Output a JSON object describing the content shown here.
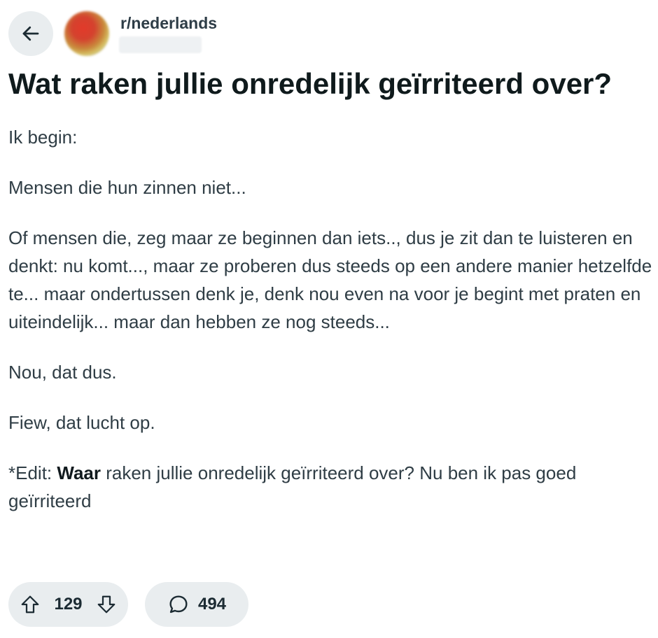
{
  "header": {
    "subreddit": "r/nederlands"
  },
  "post": {
    "title": "Wat raken jullie onredelijk geïrriteerd over?",
    "paragraphs": [
      "Ik begin:",
      "Mensen die hun zinnen niet...",
      "Of mensen die, zeg maar ze beginnen dan iets.., dus je zit dan te luisteren en denkt: nu komt..., maar ze proberen dus steeds op een andere manier hetzelfde te... maar ondertussen denk je, denk nou even na voor je begint met praten en uiteindelijk... maar dan hebben ze nog steeds...",
      "Nou, dat dus.",
      "Fiew, dat lucht op."
    ],
    "edit": {
      "prefix": "*Edit: ",
      "bold": "Waar",
      "rest": " raken jullie onredelijk geïrriteerd over? Nu ben ik pas goed geïrriteerd"
    }
  },
  "actions": {
    "vote_count": "129",
    "comment_count": "494"
  },
  "icons": {
    "back": "arrow-left-icon",
    "upvote": "arrow-up-icon",
    "downvote": "arrow-down-icon",
    "comment": "speech-bubble-icon"
  },
  "colors": {
    "pill_background": "#e9edef",
    "title": "#0f1a1c",
    "body_text": "#2f3d45"
  }
}
